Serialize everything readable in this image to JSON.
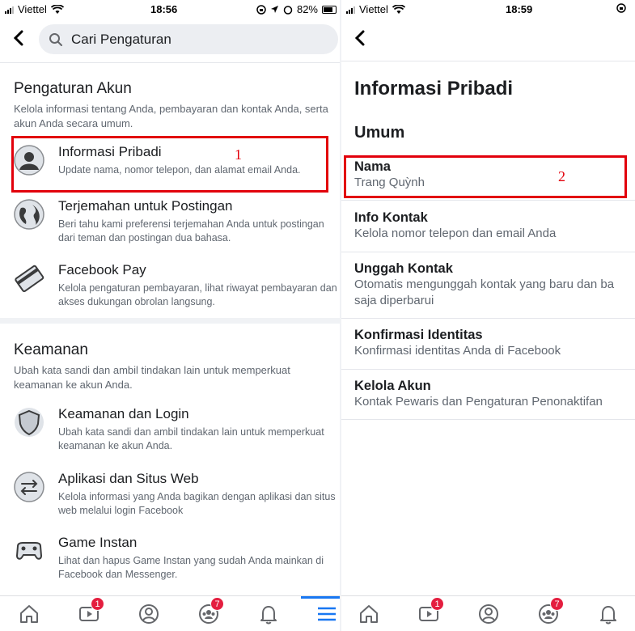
{
  "left": {
    "status": {
      "carrier": "Viettel",
      "time": "18:56",
      "battery": "82%"
    },
    "search": {
      "placeholder": "Cari Pengaturan"
    },
    "account": {
      "title": "Pengaturan Akun",
      "desc": "Kelola informasi tentang Anda, pembayaran dan kontak Anda, serta akun Anda secara umum.",
      "items": [
        {
          "title": "Informasi Pribadi",
          "desc": "Update nama, nomor telepon, dan alamat email Anda.",
          "icon": "person-icon"
        },
        {
          "title": "Terjemahan untuk Postingan",
          "desc": "Beri tahu kami preferensi terjemahan Anda untuk postingan dari teman dan postingan dua bahasa.",
          "icon": "globe-icon"
        },
        {
          "title": "Facebook Pay",
          "desc": "Kelola pengaturan pembayaran, lihat riwayat pembayaran dan akses dukungan obrolan langsung.",
          "icon": "credit-card-icon"
        }
      ]
    },
    "security": {
      "title": "Keamanan",
      "desc": "Ubah kata sandi dan ambil tindakan lain untuk memperkuat keamanan ke akun Anda.",
      "items": [
        {
          "title": "Keamanan dan Login",
          "desc": "Ubah kata sandi dan ambil tindakan lain untuk memperkuat keamanan ke akun Anda.",
          "icon": "shield-icon"
        },
        {
          "title": "Aplikasi dan Situs Web",
          "desc": "Kelola informasi yang Anda bagikan dengan aplikasi dan situs web melalui login Facebook",
          "icon": "swap-arrows-icon"
        },
        {
          "title": "Game Instan",
          "desc": "Lihat dan hapus Game Instan yang sudah Anda mainkan di Facebook dan Messenger.",
          "icon": "gamepad-icon"
        }
      ]
    },
    "annotation": "1",
    "tabs": {
      "video_badge": "1",
      "groups_badge": "7"
    }
  },
  "right": {
    "status": {
      "carrier": "Viettel",
      "time": "18:59"
    },
    "title": "Informasi Pribadi",
    "section": "Umum",
    "items": [
      {
        "title": "Nama",
        "desc": "Trang Quỳnh"
      },
      {
        "title": "Info Kontak",
        "desc": "Kelola nomor telepon dan email Anda"
      },
      {
        "title": "Unggah Kontak",
        "desc": "Otomatis mengunggah kontak yang baru dan ba saja diperbarui"
      },
      {
        "title": "Konfirmasi Identitas",
        "desc": "Konfirmasi identitas Anda di Facebook"
      },
      {
        "title": "Kelola Akun",
        "desc": "Kontak Pewaris dan Pengaturan Penonaktifan"
      }
    ],
    "annotation": "2",
    "tabs": {
      "video_badge": "1",
      "groups_badge": "7"
    }
  },
  "colors": {
    "accent": "#1877f2",
    "annotation": "#e2000b",
    "badge": "#e41e3f"
  }
}
